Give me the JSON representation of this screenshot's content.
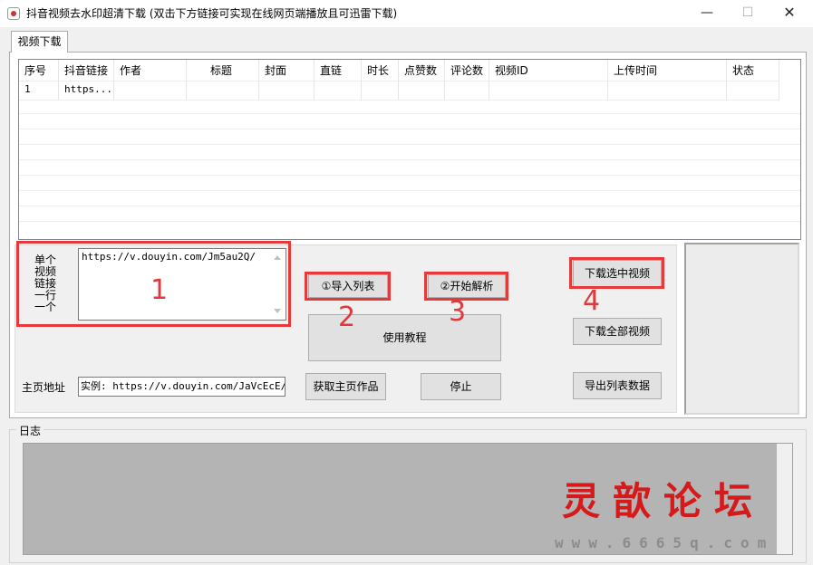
{
  "window": {
    "title": "抖音视频去水印超清下载   (双击下方链接可实现在线网页端播放且可迅雷下载)",
    "minimize": "—",
    "maximize": "☐",
    "close": "✕"
  },
  "tabs": [
    {
      "label": "视频下载"
    }
  ],
  "grid": {
    "columns": [
      "序号",
      "抖音链接",
      "作者",
      "标题",
      "封面",
      "直链",
      "时长",
      "点赞数",
      "评论数",
      "视频ID",
      "上传时间",
      "状态"
    ],
    "rows": [
      [
        "1",
        "https...",
        "",
        "",
        "",
        "",
        "",
        "",
        "",
        "",
        "",
        ""
      ]
    ]
  },
  "single_link": {
    "label": "单个视频链接一行一个",
    "value": "https://v.douyin.com/Jm5au2Q/"
  },
  "buttons": {
    "import_list": "①导入列表",
    "start_parse": "②开始解析",
    "download_selected": "下载选中视频",
    "download_all": "下载全部视频",
    "tutorial": "使用教程",
    "get_homepage": "获取主页作品",
    "stop": "停止",
    "export_list": "导出列表数据"
  },
  "homepage": {
    "label": "主页地址",
    "value": "实例: https://v.douyin.com/JaVcEcE/"
  },
  "log": {
    "label": "日志"
  },
  "annotations": {
    "n1": "1",
    "n2": "2",
    "n3": "3",
    "n4": "4"
  },
  "watermark": {
    "text": "灵歆论坛",
    "url": "www.6665q.com"
  },
  "colors": {
    "annotation_red": "#e63a3a",
    "watermark_red": "#d41a1a",
    "log_bg": "#b4b4b4"
  }
}
